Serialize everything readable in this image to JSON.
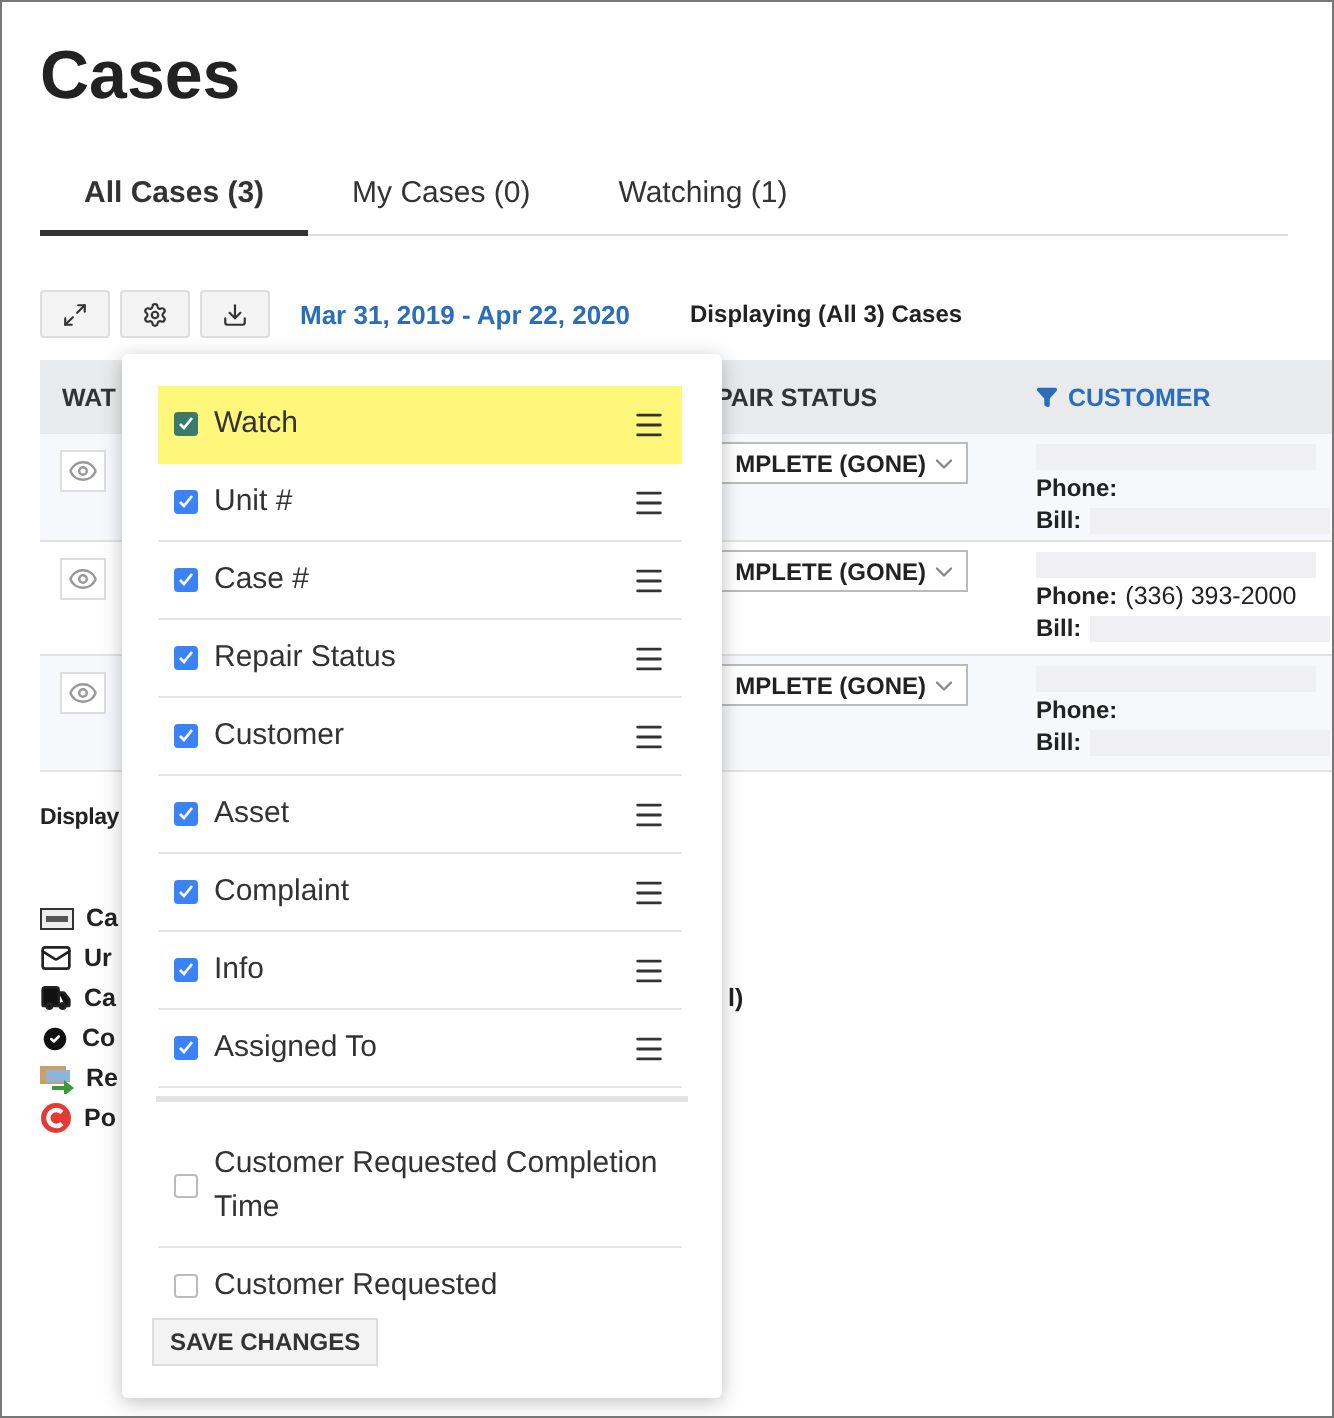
{
  "page_title": "Cases",
  "tabs": [
    {
      "label": "All Cases (3)",
      "selected": true
    },
    {
      "label": "My Cases (0)",
      "selected": false
    },
    {
      "label": "Watching (1)",
      "selected": false
    }
  ],
  "toolbar": {
    "buttons": [
      {
        "kind": "expand"
      },
      {
        "kind": "settings"
      },
      {
        "kind": "download"
      }
    ],
    "date_range": "Mar 31, 2019 - Apr 22, 2020",
    "summary": "Displaying **(All 3)** Cases"
  },
  "table": {
    "columns": [
      {
        "label": "WAT",
        "filter": false
      },
      {
        "label": "PAIR STATUS",
        "filter": false
      },
      {
        "label": "CUSTOMER",
        "filter": true
      }
    ],
    "rows": [
      {
        "status": "MPLETE (GONE)",
        "phone_label": "Phone:",
        "bill_label": "Bill:"
      },
      {
        "status": "MPLETE (GONE)",
        "phone_label": "Phone:",
        "phone": "(336) 393-2000",
        "bill_label": "Bill:"
      },
      {
        "status": "MPLETE (GONE)",
        "phone_label": "Phone:",
        "bill_label": "Bill:"
      }
    ]
  },
  "footer_text": "Display",
  "legend": [
    {
      "kind": "assist",
      "label": "Ca"
    },
    {
      "kind": "mail",
      "label": "Ur"
    },
    {
      "kind": "truck",
      "label": "Ca",
      "tail": "l)"
    },
    {
      "kind": "check",
      "label": "Co"
    },
    {
      "kind": "transfer",
      "label": "Re"
    },
    {
      "kind": "c-badge",
      "label": "Po"
    }
  ],
  "columns_menu": {
    "groups": [
      {
        "kind": "visible",
        "items": [
          {
            "label": "Watch",
            "checked": true,
            "highlighted": true
          },
          {
            "label": "Unit #",
            "checked": true,
            "highlighted": false
          },
          {
            "label": "Case #",
            "checked": true,
            "highlighted": false
          },
          {
            "label": "Repair Status",
            "checked": true,
            "highlighted": false
          },
          {
            "label": "Customer",
            "checked": true,
            "highlighted": false
          },
          {
            "label": "Asset",
            "checked": true,
            "highlighted": false
          },
          {
            "label": "Complaint",
            "checked": true,
            "highlighted": false
          },
          {
            "label": "Info",
            "checked": true,
            "highlighted": false
          },
          {
            "label": "Assigned To",
            "checked": true,
            "highlighted": false
          }
        ]
      },
      {
        "kind": "hidden",
        "items": [
          {
            "label": "Customer Requested Completion Time",
            "checked": false,
            "highlighted": false
          },
          {
            "label": "Customer Requested",
            "checked": false,
            "highlighted": false
          }
        ]
      }
    ],
    "save_button": "SAVE CHANGES"
  }
}
